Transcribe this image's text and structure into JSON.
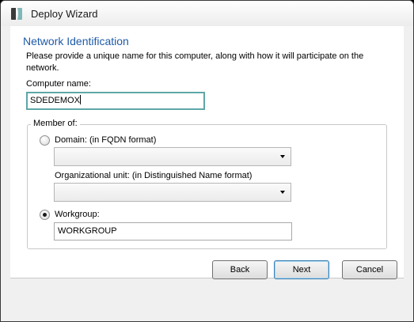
{
  "window": {
    "title": "Deploy Wizard",
    "icon": "deploy-wizard-app-icon"
  },
  "page": {
    "heading": "Network Identification",
    "description": "Please provide a unique name for this computer, along with how it will participate on the network."
  },
  "computer_name": {
    "label": "Computer name:",
    "value": "SDEDEMOX"
  },
  "member_of": {
    "label": "Member of:",
    "domain": {
      "label": "Domain: (in FQDN format)",
      "selected": false,
      "value": ""
    },
    "organizational_unit": {
      "label": "Organizational unit: (in Distinguished Name format)",
      "value": ""
    },
    "workgroup": {
      "label": "Workgroup:",
      "selected": true,
      "value": "WORKGROUP"
    }
  },
  "buttons": {
    "back": "Back",
    "next": "Next",
    "cancel": "Cancel"
  },
  "colors": {
    "heading": "#1e5aa8",
    "focus_border": "#5fa6a6",
    "default_button_border": "#3c7fb1"
  }
}
